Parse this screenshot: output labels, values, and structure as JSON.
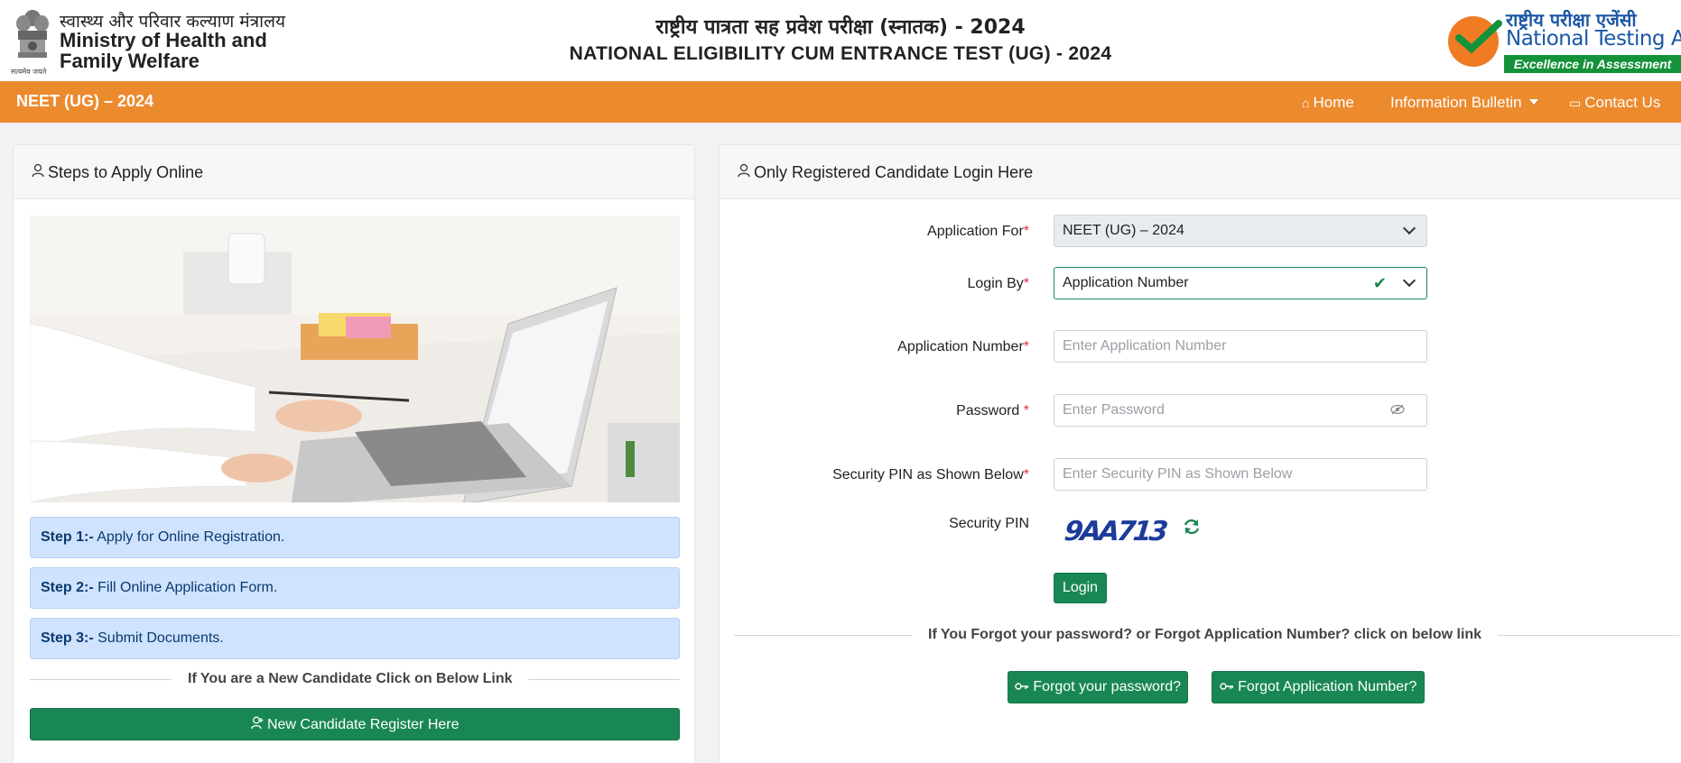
{
  "header": {
    "ministry_hindi": "स्वास्थ्य और परिवार कल्याण मंत्रालय",
    "ministry_en_line1": "Ministry of Health and",
    "ministry_en_line2": "Family Welfare",
    "emblem_caption": "सत्यमेव जयते",
    "title_hindi": "राष्ट्रीय पात्रता सह प्रवेश परीक्षा (स्नातक) - 2024",
    "title_en": "NATIONAL ELIGIBILITY CUM ENTRANCE TEST (UG) - 2024",
    "nta_hindi": "राष्ट्रीय परीक्षा एजेंसी",
    "nta_en": "National Testing Agency",
    "nta_tagline": "Excellence in Assessment"
  },
  "nav": {
    "brand": "NEET (UG) – 2024",
    "home": "Home",
    "bulletin": "Information Bulletin",
    "contact": "Contact Us"
  },
  "left_panel": {
    "title": "Steps to Apply Online",
    "steps": [
      {
        "label": "Step 1:-",
        "text": "Apply for Online Registration."
      },
      {
        "label": "Step 2:-",
        "text": "Fill Online Application Form."
      },
      {
        "label": "Step 3:-",
        "text": "Submit Documents."
      }
    ],
    "new_candidate_text": "If You are a New Candidate Click on Below Link",
    "register_button": "New Candidate Register Here"
  },
  "login_panel": {
    "title": "Only Registered Candidate Login Here",
    "application_for_label": "Application For",
    "application_for_value": "NEET (UG) – 2024",
    "login_by_label": "Login By",
    "login_by_value": "Application Number",
    "application_number_label": "Application Number",
    "application_number_placeholder": "Enter Application Number",
    "password_label": "Password",
    "password_placeholder": "Enter Password",
    "security_pin_input_label": "Security PIN as Shown Below",
    "security_pin_placeholder": "Enter Security PIN as Shown Below",
    "security_pin_label": "Security PIN",
    "captcha_value": "9AA713",
    "login_button": "Login",
    "forgot_text": "If You Forgot your password? or Forgot Application Number? click on below link",
    "forgot_password_button": "Forgot your password?",
    "forgot_appno_button": "Forgot Application Number?"
  },
  "colors": {
    "navbar": "#ec8a2e",
    "primary_green": "#198754",
    "step_bg": "#cfe2fe",
    "nta_blue": "#1a57a6"
  }
}
